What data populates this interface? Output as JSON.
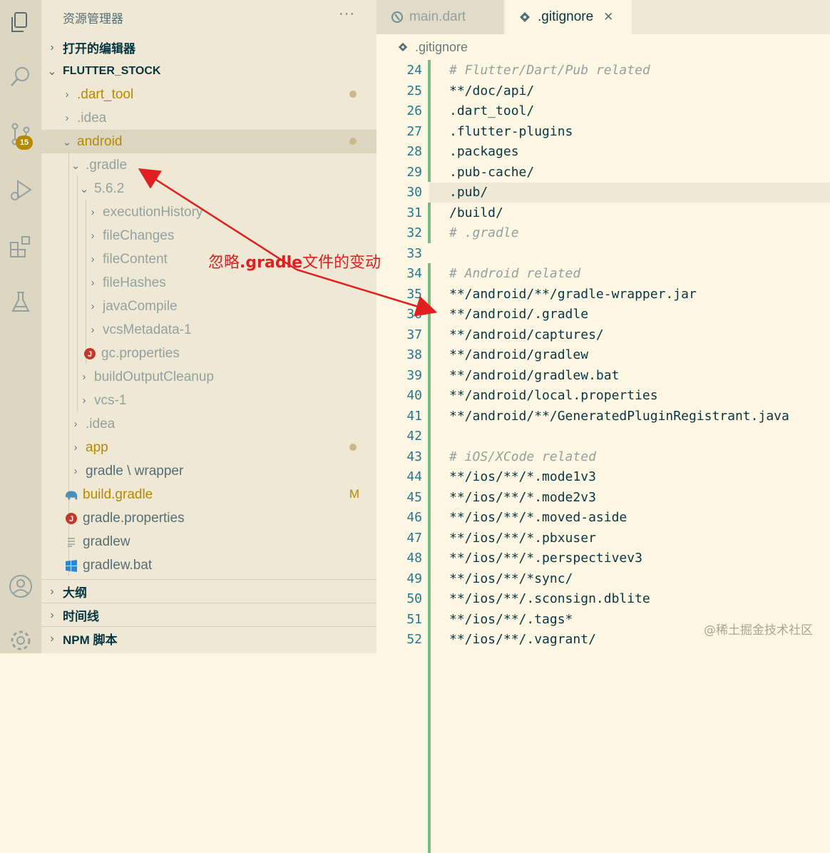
{
  "activity_bar": {
    "scm_badge": "15",
    "icons": [
      "files-icon",
      "search-icon",
      "source-control-icon",
      "run-debug-icon",
      "extensions-icon",
      "testing-icon",
      "account-icon",
      "settings-gear-icon"
    ]
  },
  "sidebar": {
    "title": "资源管理器",
    "more": "···",
    "open_editors": "打开的编辑器",
    "project": "FLUTTER_STOCK",
    "tree": [
      {
        "label": ".dart_tool",
        "mod": true
      },
      {
        "label": ".idea"
      },
      {
        "label": "android",
        "mod": true
      },
      {
        "label": ".gradle"
      },
      {
        "label": "5.6.2"
      },
      {
        "label": "executionHistory"
      },
      {
        "label": "fileChanges"
      },
      {
        "label": "fileContent"
      },
      {
        "label": "fileHashes"
      },
      {
        "label": "javaCompile"
      },
      {
        "label": "vcsMetadata-1"
      },
      {
        "label": "gc.properties"
      },
      {
        "label": "buildOutputCleanup"
      },
      {
        "label": "vcs-1"
      },
      {
        "label": ".idea"
      },
      {
        "label": "app"
      },
      {
        "label": "gradle \\ wrapper"
      },
      {
        "label": "build.gradle",
        "badge": "M"
      },
      {
        "label": "gradle.properties"
      },
      {
        "label": "gradlew"
      },
      {
        "label": "gradlew.bat"
      }
    ],
    "outline": "大纲",
    "timeline": "时间线",
    "npm": "NPM 脚本"
  },
  "tabs": [
    {
      "label": "main.dart",
      "active": false
    },
    {
      "label": ".gitignore",
      "active": true,
      "close": "✕"
    }
  ],
  "breadcrumb": ".gitignore",
  "editor": {
    "lines": [
      {
        "n": "24",
        "t": "# Flutter/Dart/Pub related",
        "c": true
      },
      {
        "n": "25",
        "t": "**/doc/api/"
      },
      {
        "n": "26",
        "t": ".dart_tool/"
      },
      {
        "n": "27",
        "t": ".flutter-plugins"
      },
      {
        "n": "28",
        "t": ".packages"
      },
      {
        "n": "29",
        "t": ".pub-cache/"
      },
      {
        "n": "30",
        "t": ".pub/"
      },
      {
        "n": "31",
        "t": "/build/"
      },
      {
        "n": "32",
        "t": "# .gradle",
        "c": true
      },
      {
        "n": "33",
        "t": ""
      },
      {
        "n": "34",
        "t": "# Android related",
        "c": true
      },
      {
        "n": "35",
        "t": "**/android/**/gradle-wrapper.jar"
      },
      {
        "n": "36",
        "t": "**/android/.gradle"
      },
      {
        "n": "37",
        "t": "**/android/captures/"
      },
      {
        "n": "38",
        "t": "**/android/gradlew"
      },
      {
        "n": "39",
        "t": "**/android/gradlew.bat"
      },
      {
        "n": "40",
        "t": "**/android/local.properties"
      },
      {
        "n": "41",
        "t": "**/android/**/GeneratedPluginRegistrant.java"
      },
      {
        "n": "42",
        "t": ""
      },
      {
        "n": "43",
        "t": "# iOS/XCode related",
        "c": true
      },
      {
        "n": "44",
        "t": "**/ios/**/*.mode1v3"
      },
      {
        "n": "45",
        "t": "**/ios/**/*.mode2v3"
      },
      {
        "n": "46",
        "t": "**/ios/**/*.moved-aside"
      },
      {
        "n": "47",
        "t": "**/ios/**/*.pbxuser"
      },
      {
        "n": "48",
        "t": "**/ios/**/*.perspectivev3"
      },
      {
        "n": "49",
        "t": "**/ios/**/*sync/"
      },
      {
        "n": "50",
        "t": "**/ios/**/.sconsign.dblite"
      },
      {
        "n": "51",
        "t": "**/ios/**/.tags*"
      },
      {
        "n": "52",
        "t": "**/ios/**/.vagrant/"
      }
    ]
  },
  "annotation": {
    "prefix": "忽略",
    "bold": ".gradle",
    "suffix": "文件的变动"
  },
  "watermark": "@稀土掘金技术社区",
  "colors": {
    "annotation": "#e02020",
    "modified": "#b58900",
    "added_gutter": "#7fb880"
  }
}
